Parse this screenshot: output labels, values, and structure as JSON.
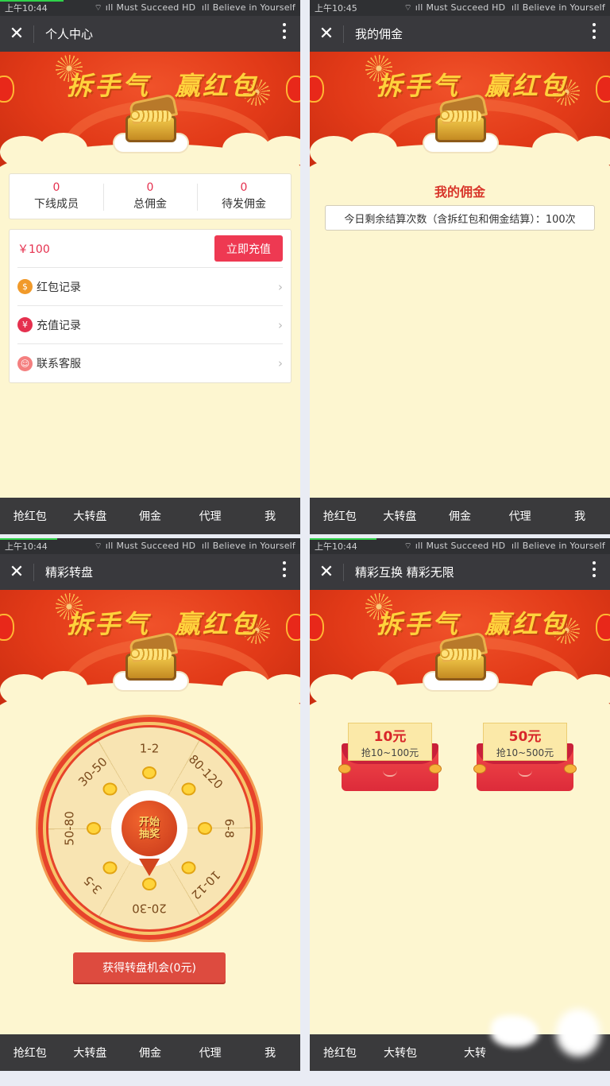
{
  "status": {
    "times": [
      "上午10:44",
      "上午10:45",
      "上午10:44",
      "上午10:44"
    ],
    "carrier1": "Must Succeed HD",
    "carrier2": "Believe in Yourself"
  },
  "banner": {
    "slogan_left": "拆手气",
    "slogan_right": "赢红包"
  },
  "tabs": [
    "抢红包",
    "大转盘",
    "佣金",
    "代理",
    "我"
  ],
  "panel1": {
    "title": "个人中心",
    "stats": [
      {
        "value": "0",
        "label": "下线成员"
      },
      {
        "value": "0",
        "label": "总佣金"
      },
      {
        "value": "0",
        "label": "待发佣金"
      }
    ],
    "balance": "￥100",
    "recharge_label": "立即充值",
    "menu": [
      {
        "label": "红包记录",
        "icon": "money-bag-icon",
        "color": "#f19a2a",
        "glyph": "$"
      },
      {
        "label": "充值记录",
        "icon": "yen-icon",
        "color": "#e5304e",
        "glyph": "¥"
      },
      {
        "label": "联系客服",
        "icon": "customer-service-icon",
        "color": "#f47f7f",
        "glyph": "☺"
      }
    ],
    "chevron": "›"
  },
  "panel2": {
    "title": "我的佣金",
    "heading": "我的佣金",
    "info": "今日剩余结算次数（含拆红包和佣金结算）：100次"
  },
  "panel3": {
    "title": "精彩转盘",
    "wheel_segments": [
      "1-2",
      "80-120",
      "6-8",
      "10-12",
      "20-30",
      "3-5",
      "50-80",
      "30-50"
    ],
    "start_line1": "开始",
    "start_line2": "抽奖",
    "chance_button": "获得转盘机会(0元)"
  },
  "panel4": {
    "title": "精彩互换 精彩无限",
    "packets": [
      {
        "amount": "10元",
        "range": "抢10~100元"
      },
      {
        "amount": "50元",
        "range": "抢10~500元"
      }
    ],
    "visible_tabs": [
      "抢红包",
      "大转包",
      "大转"
    ]
  },
  "colors": {
    "accent_red": "#ee3952",
    "title_bar": "#39393d",
    "page_bg": "#fdf6d0"
  }
}
